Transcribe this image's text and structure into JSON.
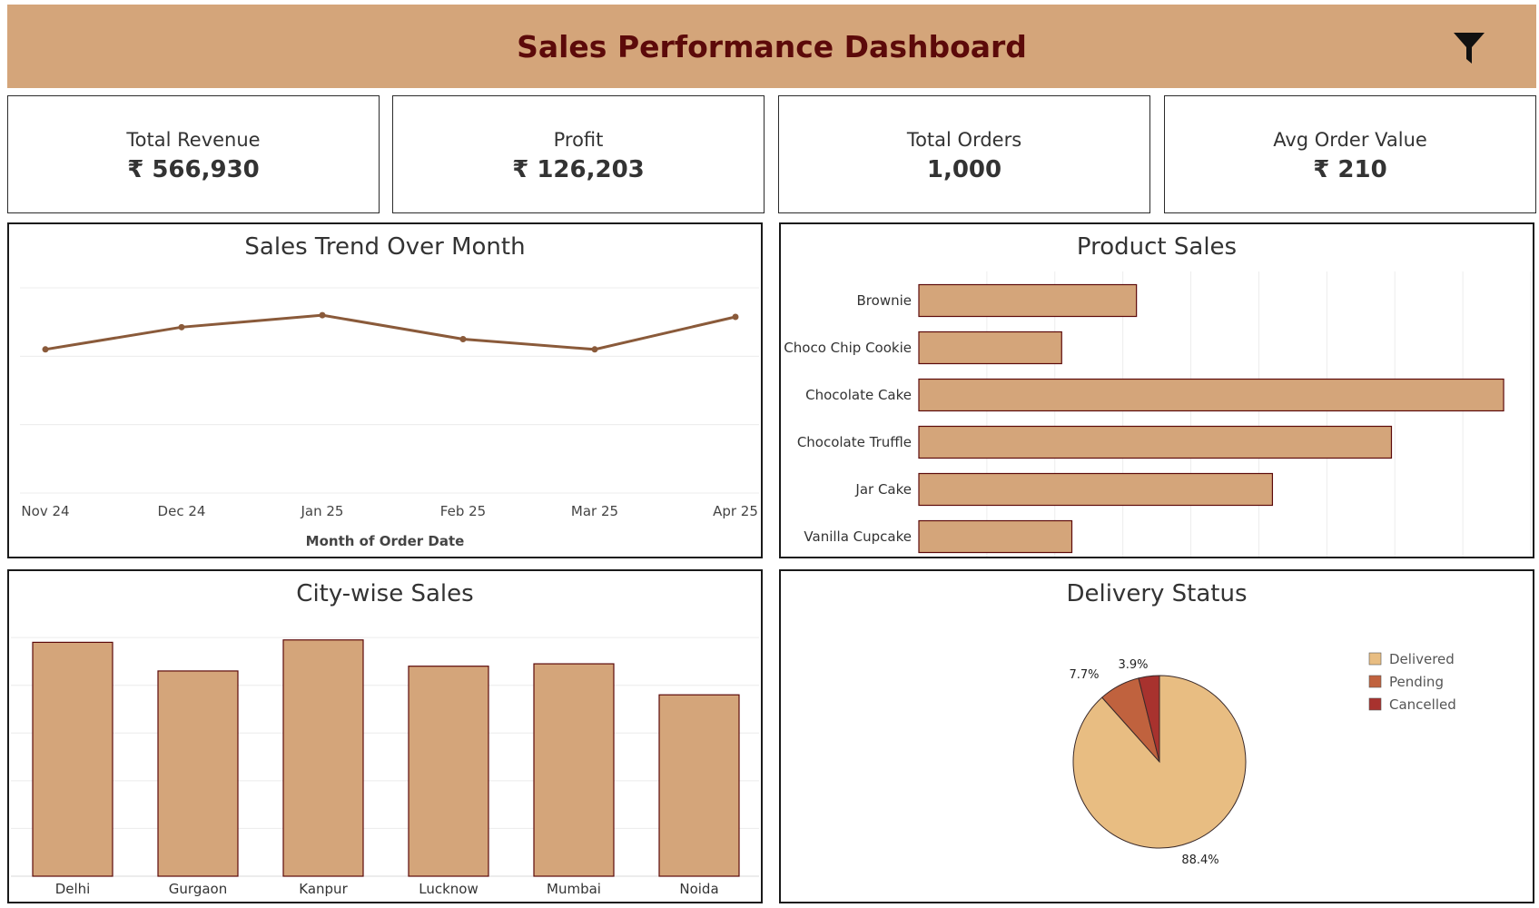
{
  "header": {
    "title": "Sales Performance Dashboard"
  },
  "kpis": [
    {
      "label": "Total Revenue",
      "value": "₹ 566,930"
    },
    {
      "label": "Profit",
      "value": "₹ 126,203"
    },
    {
      "label": "Total Orders",
      "value": "1,000"
    },
    {
      "label": "Avg Order Value",
      "value": "₹ 210"
    }
  ],
  "colors": {
    "header": "#d4a57a",
    "title": "#5c0a0a",
    "bar_fill": "#d4a57a",
    "bar_stroke": "#5c0a0a",
    "line": "#8a5a3a",
    "delivered": "#e8bd82",
    "pending": "#c0623e",
    "cancelled": "#a8322e"
  },
  "chart_data": [
    {
      "type": "line",
      "title": "Sales Trend Over Month",
      "xlabel": "Month of Order Date",
      "categories": [
        "Nov 24",
        "Dec 24",
        "Jan 25",
        "Feb 25",
        "Mar 25",
        "Apr 25"
      ],
      "values": [
        84,
        97,
        104,
        90,
        84,
        103
      ],
      "ylim": [
        0,
        120
      ],
      "grid": true
    },
    {
      "type": "bar",
      "orientation": "horizontal",
      "title": "Product Sales",
      "categories": [
        "Brownie",
        "Choco Chip Cookie",
        "Chocolate Cake",
        "Chocolate Truffle",
        "Jar Cake",
        "Vanilla Cupcake"
      ],
      "values": [
        64,
        42,
        172,
        139,
        104,
        45
      ],
      "xlim": [
        0,
        180
      ],
      "grid": true
    },
    {
      "type": "bar",
      "title": "City-wise Sales",
      "categories": [
        "Delhi",
        "Gurgaon",
        "Kanpur",
        "Lucknow",
        "Mumbai",
        "Noida"
      ],
      "values": [
        98,
        86,
        99,
        88,
        89,
        76
      ],
      "ylim": [
        0,
        105
      ],
      "grid": true
    },
    {
      "type": "pie",
      "title": "Delivery Status",
      "categories": [
        "Delivered",
        "Pending",
        "Cancelled"
      ],
      "values": [
        88.4,
        7.7,
        3.9
      ],
      "labels": [
        "88.4%",
        "7.7%",
        "3.9%"
      ],
      "legend": "right"
    }
  ]
}
